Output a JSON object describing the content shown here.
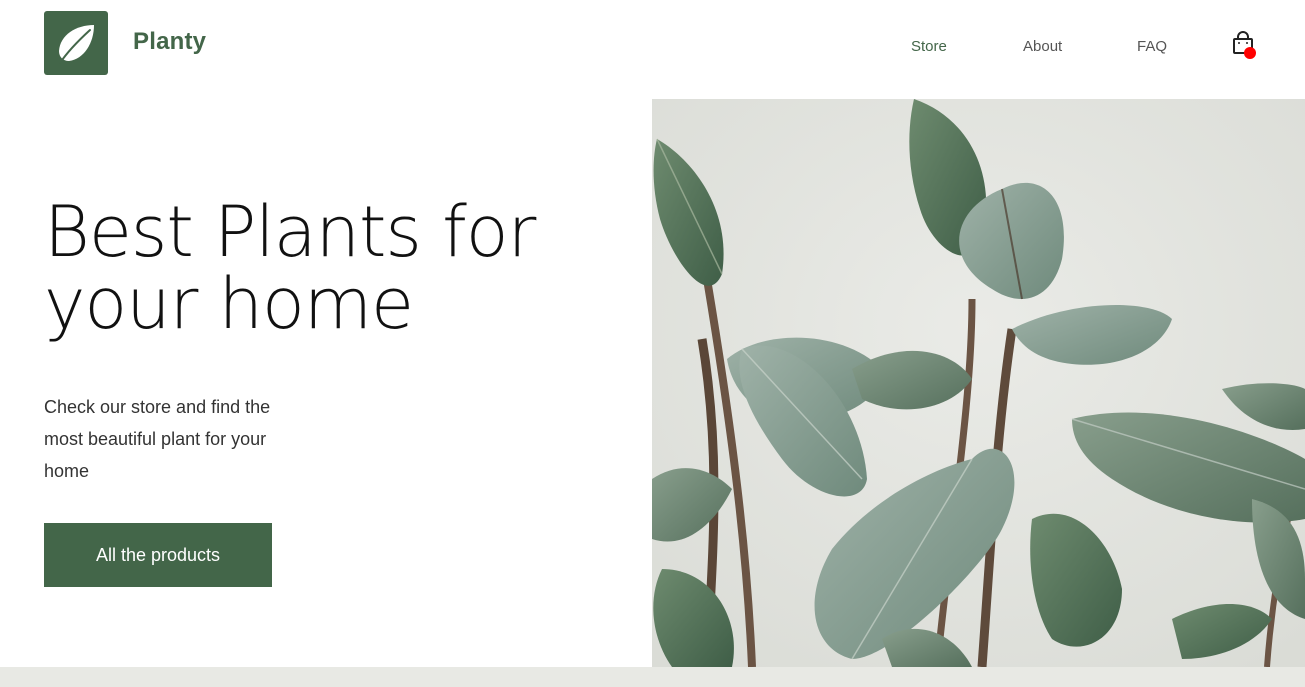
{
  "header": {
    "brand": "Planty",
    "logo_icon": "leaf-icon",
    "cart_icon": "shopping-bag-icon"
  },
  "nav": {
    "items": [
      {
        "label": "Store",
        "active": true
      },
      {
        "label": "About",
        "active": false
      },
      {
        "label": "FAQ",
        "active": false
      }
    ]
  },
  "hero": {
    "title_line1": "Best Plants for",
    "title_line2": "your home",
    "description": "Check our store and find the most beautiful plant for your home",
    "cta_label": "All the products",
    "image_icon": "rubber-plant-photo"
  },
  "colors": {
    "brand_green": "#436649",
    "cart_badge": "#ff0000",
    "image_background": "#e4e5e1",
    "bottom_strip": "#e8e9e4"
  }
}
